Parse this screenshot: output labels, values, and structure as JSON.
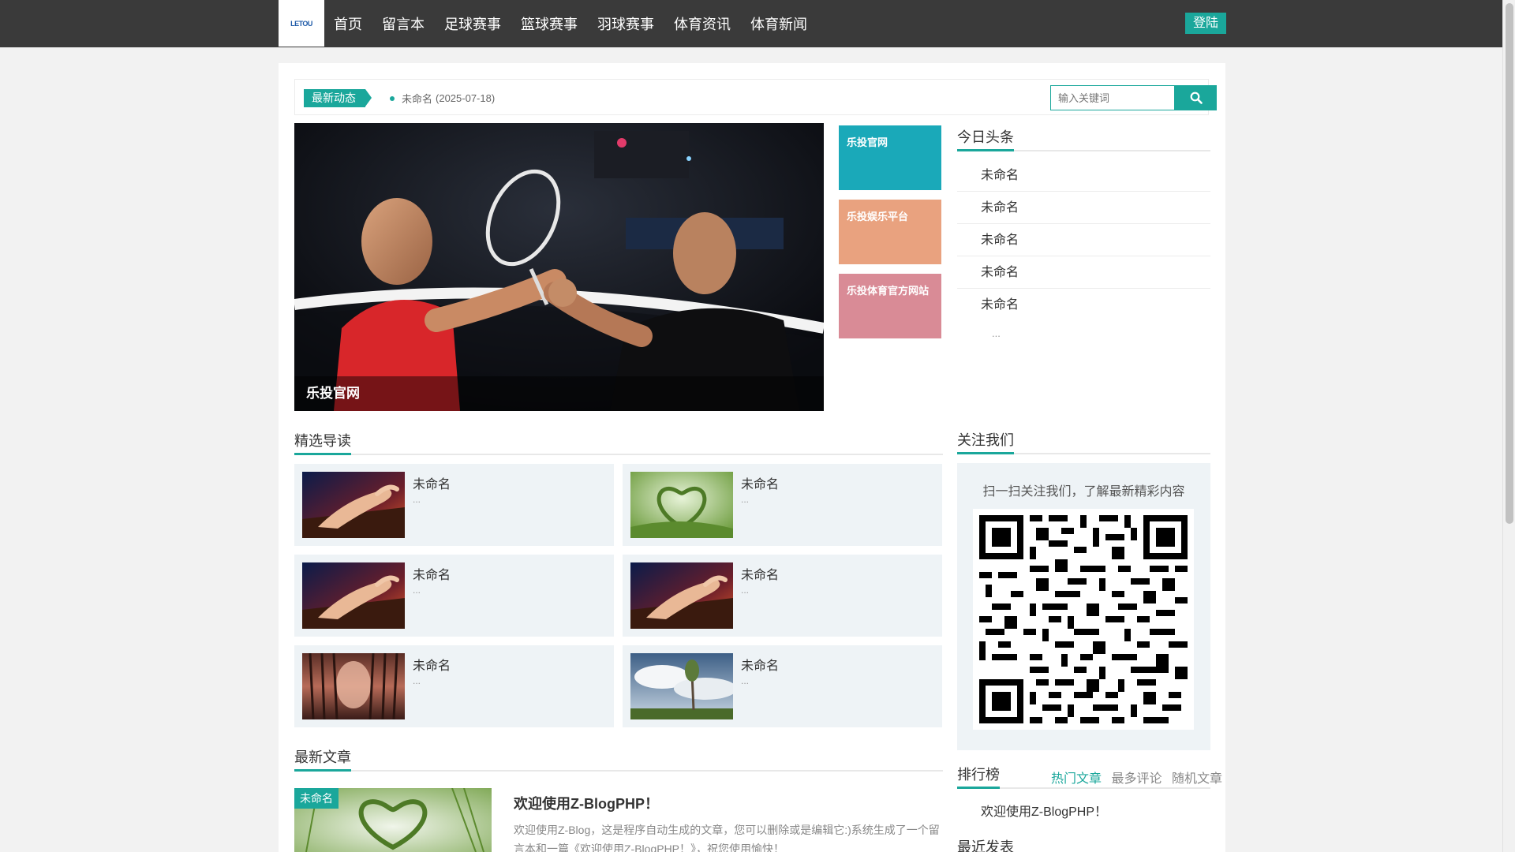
{
  "nav": {
    "logo_text": "LETOU",
    "items": [
      "首页",
      "留言本",
      "足球赛事",
      "篮球赛事",
      "羽球赛事",
      "体育资讯",
      "体育新闻"
    ],
    "login_label": "登陆"
  },
  "ticker": {
    "tag": "最新动态",
    "item_title": "未命名",
    "item_date": "(2025-07-18)"
  },
  "search": {
    "placeholder": "输入关键词",
    "icon": "search-icon"
  },
  "slider": {
    "caption": "乐投官网"
  },
  "tiles": [
    {
      "label": "乐投官网",
      "color": "#1aa9b9"
    },
    {
      "label": "乐投娱乐平台",
      "color": "#e9a27f"
    },
    {
      "label": "乐投体育官方网站",
      "color": "#d98b96"
    }
  ],
  "headlines": {
    "title": "今日头条",
    "items": [
      "未命名",
      "未命名",
      "未命名",
      "未命名",
      "未命名"
    ],
    "more": "..."
  },
  "featured": {
    "title": "精选导读",
    "cards": [
      {
        "title": "未命名",
        "desc": "...",
        "thumb": "hand-piano"
      },
      {
        "title": "未命名",
        "desc": "...",
        "thumb": "grass-heart"
      },
      {
        "title": "未命名",
        "desc": "...",
        "thumb": "hand-piano"
      },
      {
        "title": "未命名",
        "desc": "...",
        "thumb": "hand-piano"
      },
      {
        "title": "未命名",
        "desc": "...",
        "thumb": "forest-path"
      },
      {
        "title": "未命名",
        "desc": "...",
        "thumb": "sky-tree"
      }
    ]
  },
  "follow": {
    "title": "关注我们",
    "text": "扫一扫关注我们，了解最新精彩内容"
  },
  "ranking": {
    "title": "排行榜",
    "tabs": [
      "热门文章",
      "最多评论",
      "随机文章"
    ],
    "active_tab": 0,
    "items": [
      "欢迎使用Z-BlogPHP！"
    ]
  },
  "latest": {
    "title": "最新文章",
    "badge": "未命名",
    "article_title": "欢迎使用Z-BlogPHP！",
    "excerpt": "欢迎使用Z-Blog，这是程序自动生成的文章，您可以删除或是编辑它:)系统生成了一个留言本和一篇《欢迎使用Z-BlogPHP！》，祝您使用愉快！"
  },
  "recent": {
    "title": "最近发表"
  },
  "colors": {
    "accent": "#1aa79b",
    "nav_bg": "#3a3a3a",
    "card_bg": "#eef3f6"
  }
}
